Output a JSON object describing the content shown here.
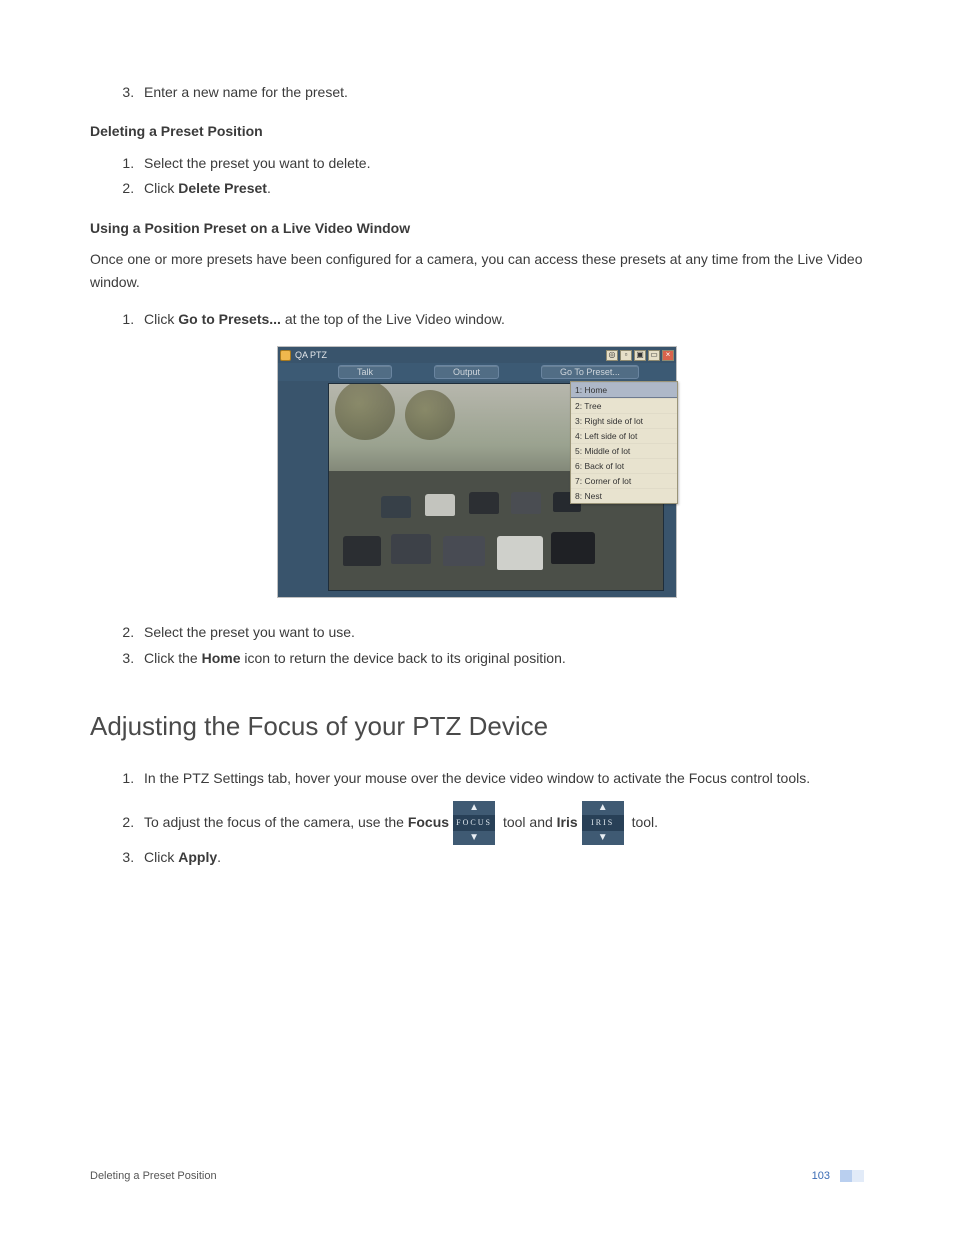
{
  "list_rename": {
    "item3": "Enter a new name for the preset."
  },
  "section_delete": {
    "heading": "Deleting a Preset Position",
    "item1": "Select the preset you want to delete.",
    "item2_pre": "Click ",
    "item2_bold": "Delete Preset",
    "item2_post": "."
  },
  "section_use": {
    "heading": "Using a Position Preset on a Live Video Window",
    "intro": "Once one or more presets have been configured for a camera, you can access these presets at any time from the Live Video window.",
    "item1_pre": "Click ",
    "item1_bold": "Go to Presets...",
    "item1_post": " at the top of the Live Video window.",
    "item2": "Select the preset you want to use.",
    "item3_pre": "Click the ",
    "item3_bold": "Home",
    "item3_post": " icon to return the device back to its original position."
  },
  "video_window": {
    "title": "QA PTZ",
    "tabs": {
      "talk": "Talk",
      "output": "Output",
      "goto": "Go To Preset..."
    },
    "presets": [
      "1: Home",
      "2: Tree",
      "3: Right side of lot",
      "4: Left side of lot",
      "5: Middle of lot",
      "6: Back of lot",
      "7: Corner of lot",
      "8: Nest"
    ]
  },
  "section_focus": {
    "heading": "Adjusting the Focus of your PTZ Device",
    "item1": "In the PTZ Settings tab, hover your mouse over the device video window to activate the Focus control tools.",
    "item2_a": "To adjust the focus of the camera, use the ",
    "item2_focus": "Focus",
    "item2_b": " tool and ",
    "item2_iris": "Iris",
    "item2_c": " tool.",
    "item3_pre": "Click ",
    "item3_bold": "Apply",
    "item3_post": ".",
    "tool_focus_label": "FOCUS",
    "tool_iris_label": "IRIS"
  },
  "footer": {
    "left": "Deleting a Preset Position",
    "page": "103"
  }
}
